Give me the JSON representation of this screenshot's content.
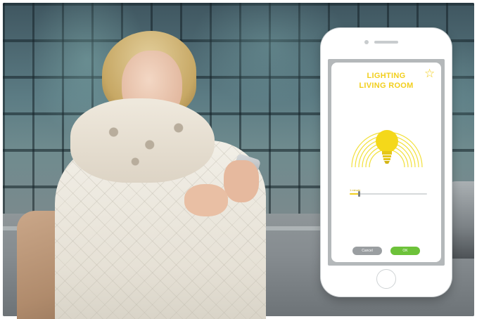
{
  "app": {
    "title_line1": "LIGHTING",
    "title_line2": "LIVING ROOM",
    "favorite_icon": "star-icon",
    "light_icon": "lightbulb-icon",
    "slider": {
      "label": "1 minute",
      "value_fraction": 0.12
    },
    "buttons": {
      "cancel": "Cancel",
      "ok": "OK"
    },
    "colors": {
      "accent": "#f2cf1d",
      "ok": "#6dc23a",
      "cancel": "#9a9ea1"
    }
  }
}
